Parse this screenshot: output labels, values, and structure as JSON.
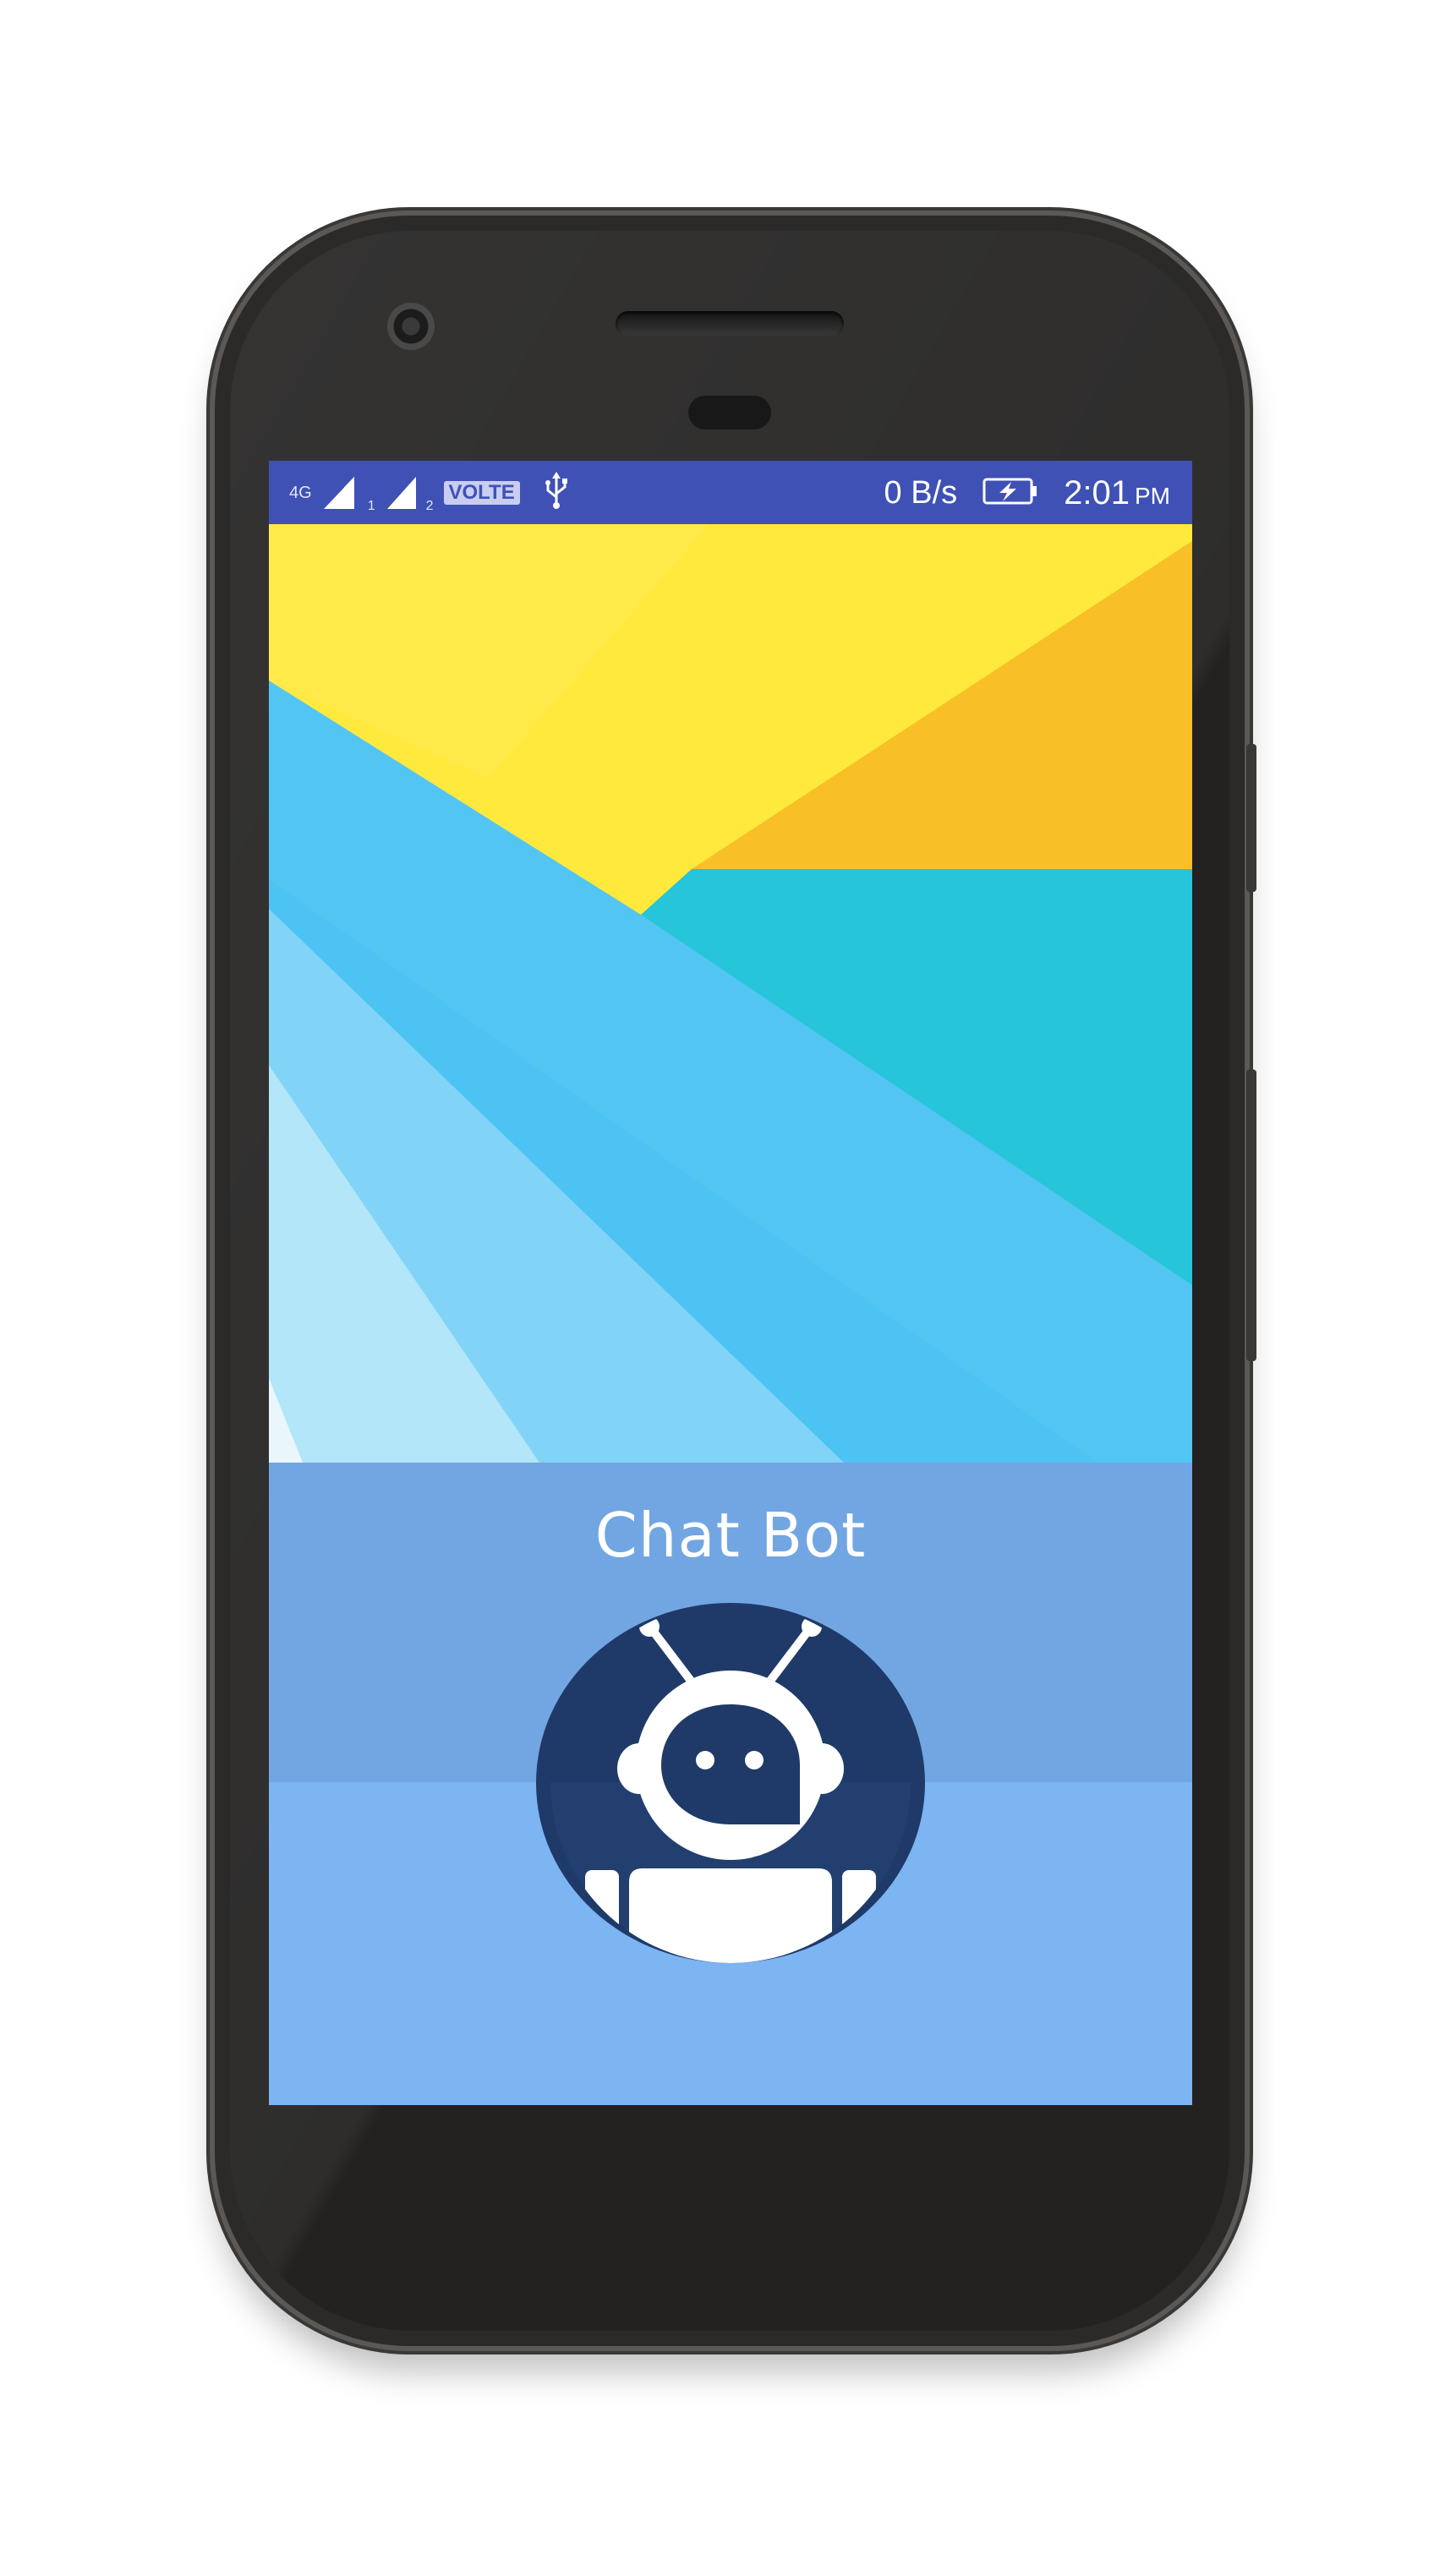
{
  "status_bar": {
    "network_type": "4G",
    "sim1_label": "1",
    "sim2_label": "2",
    "volte_label": "VOLTE",
    "usb_icon": "usb-icon",
    "data_speed": "0 B/s",
    "battery_icon": "battery-charging-icon",
    "time": "2:01",
    "ampm": "PM",
    "background_color": "#3f51b5"
  },
  "splash": {
    "app_title": "Chat Bot",
    "logo_icon": "robot-chat-icon",
    "panel_color": "#7db4f2",
    "logo_circle_color": "#1f3a68"
  }
}
